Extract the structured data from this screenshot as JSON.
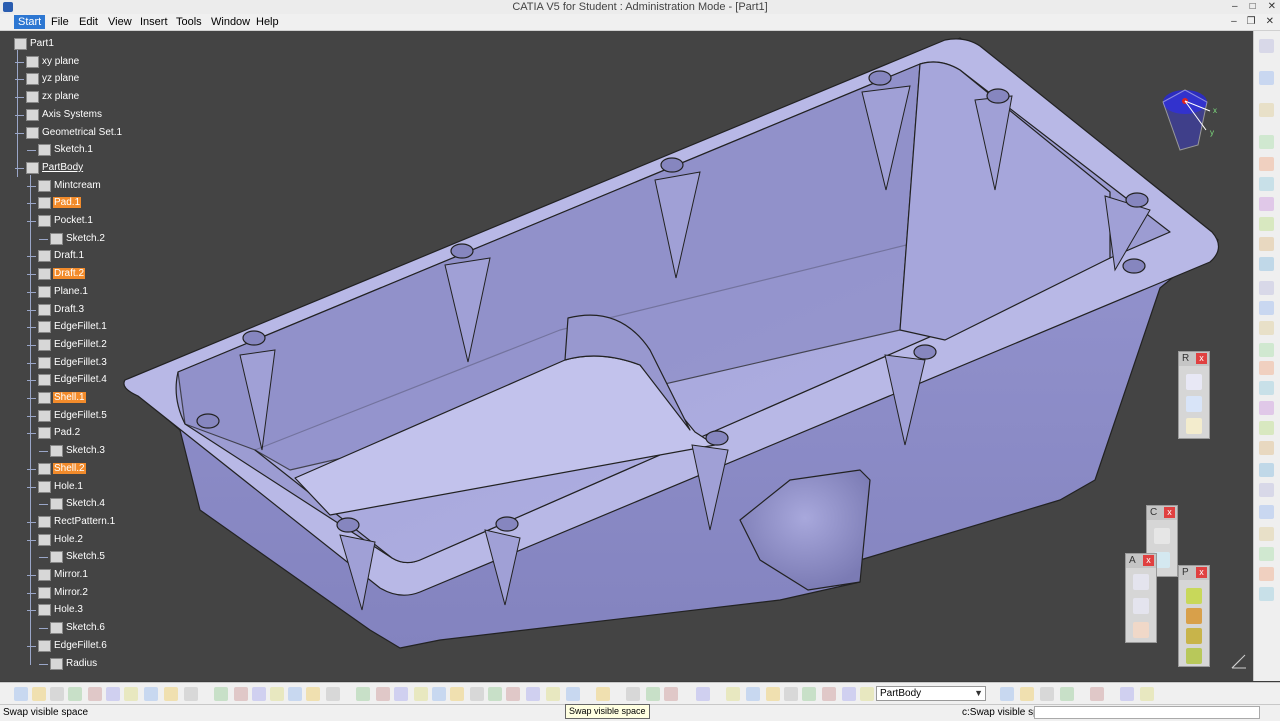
{
  "window": {
    "title": "CATIA V5 for Student : Administration Mode - [Part1]"
  },
  "menu": [
    "Start",
    "File",
    "Edit",
    "View",
    "Insert",
    "Tools",
    "Window",
    "Help"
  ],
  "tree": [
    {
      "label": "Part1",
      "level": 0,
      "icon": "part-icon",
      "hl": false,
      "ul": false
    },
    {
      "label": "xy plane",
      "level": 1,
      "icon": "plane-icon",
      "hl": false,
      "ul": false
    },
    {
      "label": "yz plane",
      "level": 1,
      "icon": "plane-icon",
      "hl": false,
      "ul": false
    },
    {
      "label": "zx plane",
      "level": 1,
      "icon": "plane-icon",
      "hl": false,
      "ul": false
    },
    {
      "label": "Axis Systems",
      "level": 1,
      "icon": "axis-icon",
      "hl": false,
      "ul": false
    },
    {
      "label": "Geometrical Set.1",
      "level": 1,
      "icon": "geometrical-set-icon",
      "hl": false,
      "ul": false
    },
    {
      "label": "Sketch.1",
      "level": 2,
      "icon": "sketch-icon",
      "hl": false,
      "ul": false
    },
    {
      "label": "PartBody",
      "level": 1,
      "icon": "partbody-icon",
      "hl": false,
      "ul": true
    },
    {
      "label": "Mintcream",
      "level": 2,
      "icon": "material-icon",
      "hl": false,
      "ul": false
    },
    {
      "label": "Pad.1",
      "level": 2,
      "icon": "pad-icon",
      "hl": true,
      "ul": false
    },
    {
      "label": "Pocket.1",
      "level": 2,
      "icon": "pocket-icon",
      "hl": false,
      "ul": false
    },
    {
      "label": "Sketch.2",
      "level": 3,
      "icon": "sketch-icon",
      "hl": false,
      "ul": false
    },
    {
      "label": "Draft.1",
      "level": 2,
      "icon": "draft-icon",
      "hl": false,
      "ul": false
    },
    {
      "label": "Draft.2",
      "level": 2,
      "icon": "draft-icon",
      "hl": true,
      "ul": false
    },
    {
      "label": "Plane.1",
      "level": 2,
      "icon": "plane-icon",
      "hl": false,
      "ul": false
    },
    {
      "label": "Draft.3",
      "level": 2,
      "icon": "draft-icon",
      "hl": false,
      "ul": false
    },
    {
      "label": "EdgeFillet.1",
      "level": 2,
      "icon": "edge-fillet-icon",
      "hl": false,
      "ul": false
    },
    {
      "label": "EdgeFillet.2",
      "level": 2,
      "icon": "edge-fillet-icon",
      "hl": false,
      "ul": false
    },
    {
      "label": "EdgeFillet.3",
      "level": 2,
      "icon": "edge-fillet-icon",
      "hl": false,
      "ul": false
    },
    {
      "label": "EdgeFillet.4",
      "level": 2,
      "icon": "edge-fillet-icon",
      "hl": false,
      "ul": false
    },
    {
      "label": "Shell.1",
      "level": 2,
      "icon": "shell-icon",
      "hl": true,
      "ul": false
    },
    {
      "label": "EdgeFillet.5",
      "level": 2,
      "icon": "edge-fillet-icon",
      "hl": false,
      "ul": false
    },
    {
      "label": "Pad.2",
      "level": 2,
      "icon": "pad-icon",
      "hl": false,
      "ul": false
    },
    {
      "label": "Sketch.3",
      "level": 3,
      "icon": "sketch-icon",
      "hl": false,
      "ul": false
    },
    {
      "label": "Shell.2",
      "level": 2,
      "icon": "shell-icon",
      "hl": true,
      "ul": false
    },
    {
      "label": "Hole.1",
      "level": 2,
      "icon": "hole-icon",
      "hl": false,
      "ul": false
    },
    {
      "label": "Sketch.4",
      "level": 3,
      "icon": "sketch-icon",
      "hl": false,
      "ul": false
    },
    {
      "label": "RectPattern.1",
      "level": 2,
      "icon": "rect-pattern-icon",
      "hl": false,
      "ul": false
    },
    {
      "label": "Hole.2",
      "level": 2,
      "icon": "hole-icon",
      "hl": false,
      "ul": false
    },
    {
      "label": "Sketch.5",
      "level": 3,
      "icon": "sketch-icon",
      "hl": false,
      "ul": false
    },
    {
      "label": "Mirror.1",
      "level": 2,
      "icon": "mirror-icon",
      "hl": false,
      "ul": false
    },
    {
      "label": "Mirror.2",
      "level": 2,
      "icon": "mirror-icon",
      "hl": false,
      "ul": false
    },
    {
      "label": "Hole.3",
      "level": 2,
      "icon": "hole-icon",
      "hl": false,
      "ul": false
    },
    {
      "label": "Sketch.6",
      "level": 3,
      "icon": "sketch-icon",
      "hl": false,
      "ul": false
    },
    {
      "label": "EdgeFillet.6",
      "level": 2,
      "icon": "edge-fillet-icon",
      "hl": false,
      "ul": false
    },
    {
      "label": "Radius",
      "level": 3,
      "icon": "radius-icon",
      "hl": false,
      "ul": false
    }
  ],
  "compass": {
    "x_label": "x",
    "y_label": "y"
  },
  "toolboxes": {
    "r": "R",
    "c": "C",
    "a": "A",
    "p": "P",
    "close": "x"
  },
  "bottom_toolbar": {
    "current_body": "PartBody"
  },
  "status": {
    "message": "Swap visible space",
    "tooltip": "Swap visible space",
    "command": "c:Swap visible space",
    "command_value": ""
  },
  "colors": {
    "viewport_bg": "#444444",
    "part_face": "#a9a9dd",
    "part_light": "#c9c9ef",
    "part_shadow": "#7f7fb6",
    "highlight": "#f28b2b",
    "tree_text": "#ffffff",
    "accent_blue": "#2d77d2"
  }
}
